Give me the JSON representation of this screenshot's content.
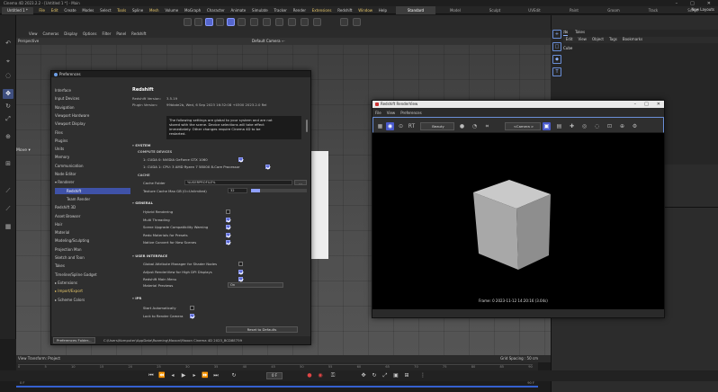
{
  "window": {
    "title": "Cinema 4D 2023.2.2 - [Untitled 1 *] - Main"
  },
  "menubar": {
    "doc_tab": "Untitled 1 *",
    "items": [
      {
        "label": "File",
        "style": "hl"
      },
      {
        "label": "Edit",
        "style": "hl"
      },
      {
        "label": "Create",
        "style": ""
      },
      {
        "label": "Modes",
        "style": ""
      },
      {
        "label": "Select",
        "style": ""
      },
      {
        "label": "Tools",
        "style": "hl"
      },
      {
        "label": "Spline",
        "style": ""
      },
      {
        "label": "Mesh",
        "style": "hl"
      },
      {
        "label": "Volume",
        "style": ""
      },
      {
        "label": "MoGraph",
        "style": ""
      },
      {
        "label": "Character",
        "style": ""
      },
      {
        "label": "Animate",
        "style": ""
      },
      {
        "label": "Simulate",
        "style": ""
      },
      {
        "label": "Tracker",
        "style": ""
      },
      {
        "label": "Render",
        "style": ""
      },
      {
        "label": "Extensions",
        "style": "hl"
      },
      {
        "label": "Redshift",
        "style": ""
      },
      {
        "label": "Window",
        "style": "hl"
      },
      {
        "label": "Help",
        "style": ""
      }
    ],
    "layouts": [
      "Standard",
      "Model",
      "Sculpt",
      "UVEdit",
      "Paint",
      "Groom",
      "Track",
      "Script",
      "Nodes"
    ],
    "active_layout": "Standard",
    "new_layouts": "New Layouts"
  },
  "viewport": {
    "menu": [
      "View",
      "Cameras",
      "Display",
      "Options",
      "Filter",
      "Panel",
      "Redshift"
    ],
    "projection": "Perspective",
    "camera": "Default Camera ∘·",
    "move_label": "Move ▾",
    "view_transform": "View Transform: Project",
    "grid_spacing": "Grid Spacing : 50 cm"
  },
  "objects_panel": {
    "tabs": [
      "Objects",
      "Takes"
    ],
    "menu": [
      "File",
      "Edit",
      "View",
      "Object",
      "Tags",
      "Bookmarks"
    ],
    "item": "Cube"
  },
  "timeline": {
    "ruler": [
      "0",
      "5",
      "10",
      "15",
      "20",
      "25",
      "30",
      "35",
      "40",
      "45",
      "50",
      "55",
      "60",
      "65",
      "70",
      "75",
      "80",
      "85",
      "90"
    ],
    "frame": "0 F",
    "start": "0 F",
    "end": "90 F"
  },
  "preferences": {
    "title": "Preferences",
    "nav": [
      {
        "label": "Interface",
        "type": "",
        "y": 0
      },
      {
        "label": "Input Devices",
        "type": "",
        "y": 1
      },
      {
        "label": "Navigation",
        "type": "",
        "y": 2
      },
      {
        "label": "Viewport Hardware",
        "type": "",
        "y": 3
      },
      {
        "label": "Viewport Display",
        "type": "",
        "y": 4
      },
      {
        "label": "Files",
        "type": "",
        "y": 5
      },
      {
        "label": "Plugins",
        "type": "",
        "y": 6
      },
      {
        "label": "Units",
        "type": "",
        "y": 7
      },
      {
        "label": "Memory",
        "type": "",
        "y": 8
      },
      {
        "label": "Communication",
        "type": "",
        "y": 9
      },
      {
        "label": "Node Editor",
        "type": "",
        "y": 10
      },
      {
        "label": "▾ Renderer",
        "type": "",
        "y": 11
      },
      {
        "label": "Redshift",
        "type": "sub sel",
        "y": 12
      },
      {
        "label": "Team Render",
        "type": "sub",
        "y": 13
      },
      {
        "label": "Redshift 3D",
        "type": "",
        "y": 14
      },
      {
        "label": "Asset Browser",
        "type": "",
        "y": 15
      },
      {
        "label": "Hair",
        "type": "",
        "y": 16
      },
      {
        "label": "Material",
        "type": "",
        "y": 17
      },
      {
        "label": "Modeling/Sculpting",
        "type": "",
        "y": 18
      },
      {
        "label": "Projection Man",
        "type": "",
        "y": 19
      },
      {
        "label": "Sketch and Toon",
        "type": "",
        "y": 20
      },
      {
        "label": "Takes",
        "type": "",
        "y": 21
      },
      {
        "label": "Timeline/Spline Gadget",
        "type": "",
        "y": 22
      },
      {
        "label": "▸ Extensions",
        "type": "",
        "y": 23
      },
      {
        "label": "▸ Import/Export",
        "type": "hl",
        "y": 24
      },
      {
        "label": "▸ Scheme Colors",
        "type": "",
        "y": 25
      }
    ],
    "heading": "Redshift",
    "version_label": "Redshift Version:",
    "version_value": "3.5.19",
    "plugin_label": "Plugin Version:",
    "plugin_value": "99bbde2b, Wed, 6 Sep 2023 16:32:08 +0300 2023.2.0 Rel",
    "notice_lines": [
      "The following settings are global to your system and are not",
      "stored with the scene. Device selections will take effect",
      "immediately. Other changes require Cinema 4D to be",
      "restarted."
    ],
    "system": {
      "section": "SYSTEM",
      "compute_devices": "COMPUTE DEVICES",
      "device1": "1: CUDA 0: NVIDIA GeForce GTX 1060",
      "device2": "1: CUDA 1: CPU: 3 AMD Ryzen 7 5800X 8-Core Processor",
      "cache": "CACHE",
      "cache_folder_label": "Cache Folder",
      "cache_folder_value": "%USERPROFILE%",
      "cache_browse": "...",
      "texture_cache_label": "Texture Cache Max GB (0=Unlimited)",
      "texture_cache_value": "32"
    },
    "general": {
      "section": "GENERAL",
      "items": [
        {
          "label": "Hybrid Rendering",
          "checked": false
        },
        {
          "label": "Multi Threading",
          "checked": true
        },
        {
          "label": "Scene Upgrade Compatibility Warning",
          "checked": true
        },
        {
          "label": "Redo Materials for Presets",
          "checked": true
        },
        {
          "label": "Native Convert for New Scenes",
          "checked": true
        }
      ]
    },
    "user_interface": {
      "section": "USER INTERFACE",
      "items": [
        {
          "label": "Global Attribute Manager for Shader Nodes",
          "checked": false
        },
        {
          "label": "Adjust RenderView for High DPI Displays",
          "checked": true
        },
        {
          "label": "Redshift Main Menu",
          "checked": true
        }
      ],
      "material_previews_label": "Material Previews",
      "material_previews_value": "On"
    },
    "ipr": {
      "section": "IPR",
      "items": [
        {
          "label": "Start Automatically",
          "checked": false
        },
        {
          "label": "Lock to Render Camera",
          "checked": true
        }
      ]
    },
    "reset_button": "Reset to Defaults",
    "prefs_folder_button": "Preferences Folder...",
    "path": "C:\\Users\\Komputer\\AppData\\Roaming\\Maxon\\Maxon Cinema 4D 2023_BCD8E759"
  },
  "renderview": {
    "title": "Redshift RenderView",
    "menu": [
      "File",
      "View",
      "Preferences"
    ],
    "beauty": "Beauty",
    "camera": "<Camera >",
    "frame_info": "Frame: 0  2023-11-12  14:20:16  (3.04s)"
  },
  "colors": {
    "accent": "#5c6bd8",
    "highlight": "#e8c86a",
    "selection": "#3f52a8",
    "timeline_blue": "#3560d0"
  }
}
